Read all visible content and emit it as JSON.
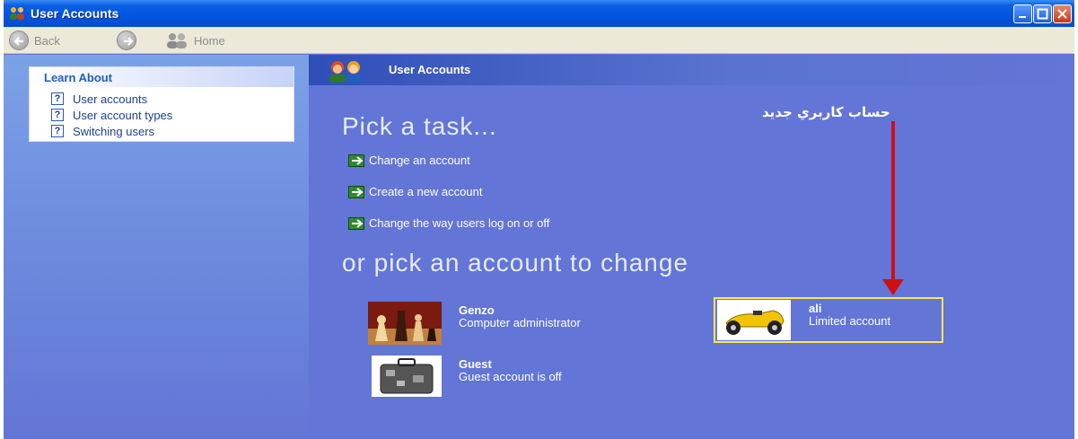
{
  "window": {
    "title": "User Accounts"
  },
  "toolbar": {
    "back_label": "Back",
    "home_label": "Home"
  },
  "learn_about": {
    "heading": "Learn About",
    "items": [
      {
        "label": "User accounts",
        "icon": "help-icon"
      },
      {
        "label": "User account types",
        "icon": "help-icon"
      },
      {
        "label": "Switching users",
        "icon": "help-icon"
      }
    ]
  },
  "main": {
    "header_title": "User Accounts",
    "pick_task": "Pick a task...",
    "tasks": [
      {
        "label": "Change an account"
      },
      {
        "label": "Create a new account"
      },
      {
        "label": "Change the way users log on or off"
      }
    ],
    "pick_account": "or pick an account to change",
    "accounts": [
      {
        "name": "Genzo",
        "type": "Computer administrator",
        "picture": "chess-pieces"
      },
      {
        "name": "ali",
        "type": "Limited account",
        "picture": "race-car"
      },
      {
        "name": "Guest",
        "type": "Guest account is off",
        "picture": "suitcase"
      }
    ]
  },
  "annotation": {
    "text": "حساب كاربري جديد",
    "color": "#d01010"
  },
  "colors": {
    "title_bar": "#0054e3",
    "main_bg": "#6375d6",
    "highlight": "#ffe84a"
  }
}
